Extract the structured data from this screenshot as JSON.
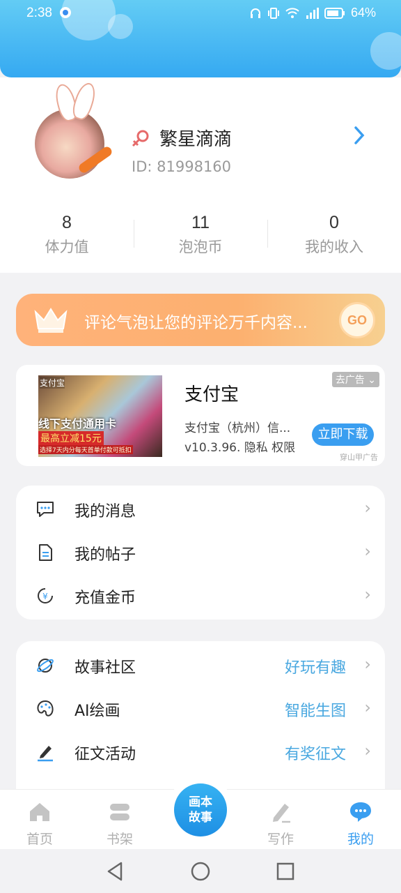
{
  "status_bar": {
    "time": "2:38",
    "battery": "64%"
  },
  "profile": {
    "nickname": "繁星滴滴",
    "id_label": "ID:",
    "id_value": "81998160",
    "stats": [
      {
        "value": "8",
        "label": "体力值"
      },
      {
        "value": "11",
        "label": "泡泡币"
      },
      {
        "value": "0",
        "label": "我的收入"
      }
    ]
  },
  "promo": {
    "text": "评论气泡让您的评论万千内容...",
    "go_label": "GO"
  },
  "ad": {
    "image_texts": [
      "支付宝",
      "线下支付通用卡",
      "最高立减15元",
      "选择7天内分每天首单付款可抵扣"
    ],
    "title": "支付宝",
    "company": "支付宝（杭州）信...",
    "version": "v10.3.96. 隐私  权限",
    "remove_label": "去广告",
    "download_label": "立即下载",
    "source": "穿山甲广告"
  },
  "menu1": [
    {
      "label": "我的消息"
    },
    {
      "label": "我的帖子"
    },
    {
      "label": "充值金币"
    }
  ],
  "menu2": [
    {
      "label": "故事社区",
      "right": "好玩有趣"
    },
    {
      "label": "AI绘画",
      "right": "智能生图"
    },
    {
      "label": "征文活动",
      "right": "有奖征文"
    }
  ],
  "tabs": [
    {
      "label": "首页"
    },
    {
      "label": "书架"
    },
    {
      "label": "画本\n故事"
    },
    {
      "label": "写作"
    },
    {
      "label": "我的"
    }
  ],
  "colors": {
    "accent": "#3a9ef0",
    "header": "#4fbcf3",
    "promo": "#fcb06f"
  }
}
